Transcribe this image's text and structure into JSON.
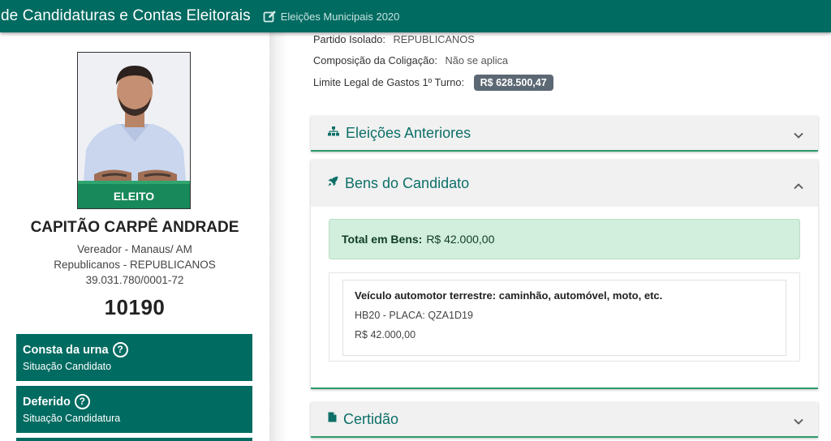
{
  "header": {
    "title": "de Candidaturas e Contas Eleitorais",
    "election": "Eleições Municipais 2020",
    "bg_color": "#006b61"
  },
  "candidate": {
    "status_badge": "ELEITO",
    "name": "CAPITÃO CARPÊ ANDRADE",
    "office": "Vereador - Manaus/ AM",
    "party": "Republicanos - REPUBLICANOS",
    "cnpj": "39.031.780/0001-72",
    "number": "10190"
  },
  "status_cards": [
    {
      "title": "Consta da urna",
      "subtitle": "Situação Candidato"
    },
    {
      "title": "Deferido",
      "subtitle": "Situação Candidatura"
    }
  ],
  "details": {
    "party_isolated_label": "Partido Isolado:",
    "party_isolated_value": "REPUBLICANOS",
    "coalition_label": "Composição da Coligação:",
    "coalition_value": "Não se aplica",
    "spending_limit_label": "Limite Legal de Gastos 1º Turno:",
    "spending_limit_value": "R$ 628.500,47"
  },
  "panels": {
    "previous_elections": {
      "title": "Eleições Anteriores",
      "icon": "sitemap-icon",
      "expanded": false
    },
    "assets": {
      "title": "Bens do Candidato",
      "icon": "rocket-icon",
      "expanded": true,
      "total_label": "Total em Bens:",
      "total_value": "R$ 42.000,00",
      "items": [
        {
          "type": "Veículo automotor terrestre: caminhão, automóvel, moto, etc.",
          "description": "HB20 - PLACA: QZA1D19",
          "value": "R$ 42.000,00"
        }
      ]
    },
    "certificate": {
      "title": "Certidão",
      "icon": "file-icon",
      "expanded": false
    }
  },
  "colors": {
    "accent_green": "#2e9a6a",
    "elected_badge": "#17895a",
    "panel_title": "#0d6f68",
    "total_box_bg": "#d2eedd"
  }
}
